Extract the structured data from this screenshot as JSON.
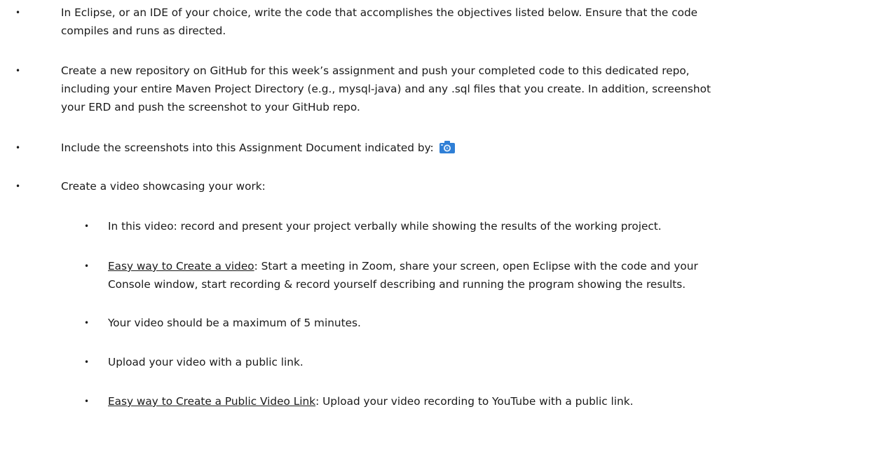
{
  "bullets": [
    {
      "lines": [
        "In Eclipse, or an IDE of your choice, write the code that accomplishes the objectives listed below. Ensure that the code",
        "compiles and runs as directed."
      ]
    },
    {
      "lines": [
        "Create a new repository on GitHub for this week’s assignment and push your completed code to this dedicated repo,",
        "including your entire Maven Project Directory (e.g., mysql-java) and any .sql files that you create.  In addition, screenshot",
        "your ERD and push the screenshot to your GitHub repo."
      ]
    },
    {
      "text": "Include the screenshots into this Assignment Document indicated by:",
      "icon": "camera-icon",
      "icon_color": "#2f7fd6"
    },
    {
      "text": "Create a video showcasing your work:"
    }
  ],
  "sub_bullets": [
    {
      "text": "In this video: record and present your project verbally while showing the results of the working project."
    },
    {
      "link": "Easy way to Create a video",
      "lines": [
        ":  Start a meeting in Zoom, share your screen, open Eclipse with the code and your",
        "Console window, start recording & record yourself describing and running the program showing the results."
      ]
    },
    {
      "text": "Your video should be a maximum of 5 minutes."
    },
    {
      "text": "Upload your video with a public link."
    },
    {
      "link": "Easy way to Create a Public Video Link",
      "text": ":  Upload your video recording to YouTube with a public link."
    }
  ],
  "bullet_glyph": "•"
}
